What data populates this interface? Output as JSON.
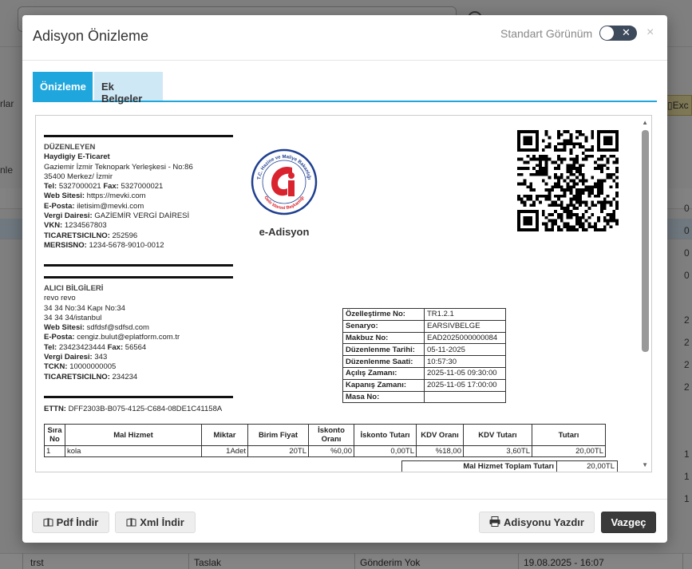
{
  "background": {
    "left_texts": [
      "rlar",
      "nle"
    ],
    "exc_label": "Exc",
    "right_values": [
      "0",
      "0",
      "0",
      "0",
      "2",
      "2",
      "2",
      "2",
      "1",
      "1",
      "1"
    ],
    "bottom_row": {
      "name": "trst",
      "status": "Taslak",
      "send_status": "Gönderim Yok",
      "date": "19.08.2025 - 16:07"
    }
  },
  "modal": {
    "title": "Adisyon Önizleme",
    "view_toggle_label": "Standart Görünüm",
    "close_glyph": "×",
    "tabs": [
      {
        "label": "Önizleme",
        "active": true
      },
      {
        "label": "Ek Belgeler",
        "active": false
      }
    ]
  },
  "document": {
    "issuer": {
      "section_title": "DÜZENLEYEN",
      "name": "Haydigiy E-Ticaret",
      "address_line1": "Gaziemir İzmir Teknopark Yerleşkesi - No:86",
      "address_line2": "35400 Merkez/ İzmir",
      "tel_label": "Tel:",
      "tel": "5327000021",
      "fax_label": "Fax:",
      "fax": "5327000021",
      "website_label": "Web Sitesi:",
      "website": "https://mevki.com",
      "email_label": "E-Posta:",
      "email": "iletisim@mevki.com",
      "tax_office_label": "Vergi Dairesi:",
      "tax_office": "GAZİEMİR VERGİ DAİRESİ",
      "vkn_label": "VKN:",
      "vkn": "1234567803",
      "trade_reg_label": "TICARETSICILNO:",
      "trade_reg": "252596",
      "mersis_label": "MERSISNO:",
      "mersis": "1234-5678-9010-0012"
    },
    "buyer": {
      "section_title": "ALICI BİLGİLERİ",
      "name": "revo revo",
      "address_line1": "34 34 No:34 Kapı No:34",
      "address_line2": "34 34 34/istanbul",
      "website_label": "Web Sitesi:",
      "website": "sdfdsf@sdfsd.com",
      "email_label": "E-Posta:",
      "email": "cengiz.bulut@eplatform.com.tr",
      "tel_label": "Tel:",
      "tel": "23423423444",
      "fax_label": "Fax:",
      "fax": "56564",
      "tax_office_label": "Vergi Dairesi:",
      "tax_office": "343",
      "tckn_label": "TCKN:",
      "tckn": "10000000005",
      "trade_reg_label": "TICARETSICILNO:",
      "trade_reg": "234234"
    },
    "ettn_label": "ETTN:",
    "ettn": "DFF2303B-B075-4125-C684-08DE1C41158A",
    "logo": {
      "caption": "e-Adisyon",
      "ring_top": "T.C. Hazine ve Maliye Bakanlığı",
      "ring_bottom": "Gelir İdaresi Başkanlığı",
      "color": "#d9232e",
      "ring_color": "#1f3f8f"
    },
    "info_table": [
      {
        "label": "Özelleştirme No:",
        "value": "TR1.2.1"
      },
      {
        "label": "Senaryo:",
        "value": "EARSIVBELGE"
      },
      {
        "label": "Makbuz No:",
        "value": "EAD2025000000084"
      },
      {
        "label": "Düzenlenme Tarihi:",
        "value": "05-11-2025"
      },
      {
        "label": "Düzenlenme Saati:",
        "value": "10:57:30"
      },
      {
        "label": "Açılış Zamanı:",
        "value": "2025-11-05 09:30:00"
      },
      {
        "label": "Kapanış Zamanı:",
        "value": "2025-11-05 17:00:00"
      },
      {
        "label": "Masa No:",
        "value": ""
      }
    ],
    "items_header": [
      "Sıra No",
      "Mal Hizmet",
      "Miktar",
      "Birim Fiyat",
      "İskonto Oranı",
      "İskonto Tutarı",
      "KDV Oranı",
      "KDV Tutarı",
      "Tutarı"
    ],
    "items": [
      {
        "no": "1",
        "name": "kola",
        "qty": "1Adet",
        "unit_price": "20TL",
        "discount_rate": "%0,00",
        "discount_amount": "0,00TL",
        "vat_rate": "%18,00",
        "vat_amount": "3,60TL",
        "amount": "20,00TL"
      }
    ],
    "total_label": "Mal Hizmet Toplam Tutarı",
    "total_value": "20,00TL"
  },
  "footer": {
    "pdf_button": "Pdf İndir",
    "xml_button": "Xml İndir",
    "print_button": "Adisyonu Yazdır",
    "cancel_button": "Vazgeç"
  },
  "icons": [
    "book-open-icon",
    "printer-icon",
    "close-icon",
    "toggle-x-icon",
    "file-excel-icon"
  ]
}
